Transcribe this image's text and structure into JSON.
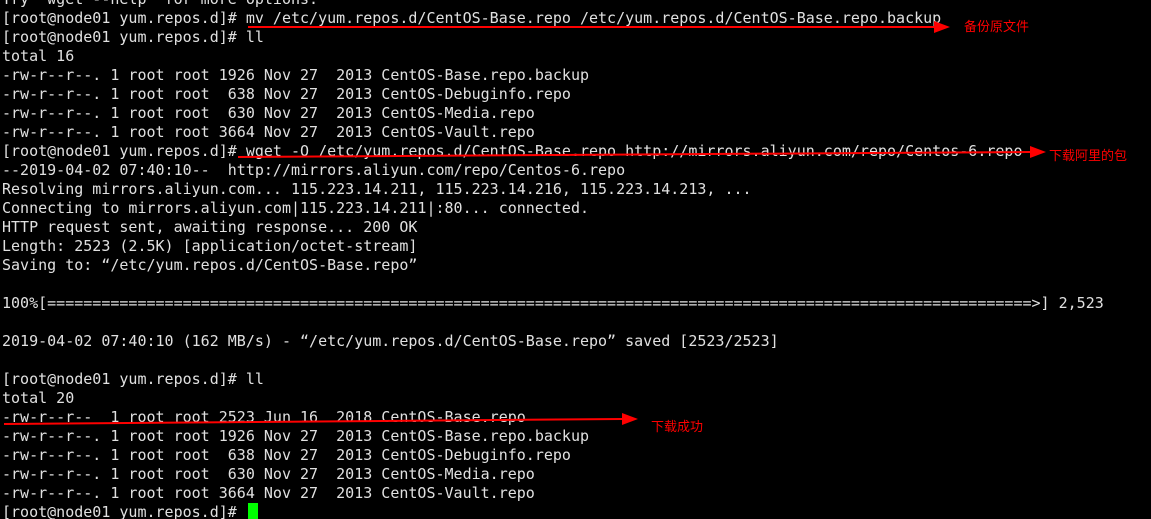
{
  "terminal": {
    "lines": [
      "Try `wget --help' for more options.",
      "[root@node01 yum.repos.d]# mv /etc/yum.repos.d/CentOS-Base.repo /etc/yum.repos.d/CentOS-Base.repo.backup",
      "[root@node01 yum.repos.d]# ll",
      "total 16",
      "-rw-r--r--. 1 root root 1926 Nov 27  2013 CentOS-Base.repo.backup",
      "-rw-r--r--. 1 root root  638 Nov 27  2013 CentOS-Debuginfo.repo",
      "-rw-r--r--. 1 root root  630 Nov 27  2013 CentOS-Media.repo",
      "-rw-r--r--. 1 root root 3664 Nov 27  2013 CentOS-Vault.repo",
      "[root@node01 yum.repos.d]# wget -O /etc/yum.repos.d/CentOS-Base.repo http://mirrors.aliyun.com/repo/Centos-6.repo",
      "--2019-04-02 07:40:10--  http://mirrors.aliyun.com/repo/Centos-6.repo",
      "Resolving mirrors.aliyun.com... 115.223.14.211, 115.223.14.216, 115.223.14.213, ...",
      "Connecting to mirrors.aliyun.com|115.223.14.211|:80... connected.",
      "HTTP request sent, awaiting response... 200 OK",
      "Length: 2523 (2.5K) [application/octet-stream]",
      "Saving to: “/etc/yum.repos.d/CentOS-Base.repo”",
      "",
      "100%[=============================================================================================================>] 2,523",
      "",
      "2019-04-02 07:40:10 (162 MB/s) - “/etc/yum.repos.d/CentOS-Base.repo” saved [2523/2523]",
      "",
      "[root@node01 yum.repos.d]# ll",
      "total 20",
      "-rw-r--r--  1 root root 2523 Jun 16  2018 CentOS-Base.repo",
      "-rw-r--r--. 1 root root 1926 Nov 27  2013 CentOS-Base.repo.backup",
      "-rw-r--r--. 1 root root  638 Nov 27  2013 CentOS-Debuginfo.repo",
      "-rw-r--r--. 1 root root  630 Nov 27  2013 CentOS-Media.repo",
      "-rw-r--r--. 1 root root 3664 Nov 27  2013 CentOS-Vault.repo",
      "[root@node01 yum.repos.d]# "
    ],
    "cursor_color": "#00ff00",
    "text_color": "#e0e0e0",
    "background_color": "#000000"
  },
  "annotations": [
    {
      "label": "备份原文件"
    },
    {
      "label": "下载阿里的包"
    },
    {
      "label": "下载成功"
    }
  ],
  "annotation_color": "#ff0000"
}
